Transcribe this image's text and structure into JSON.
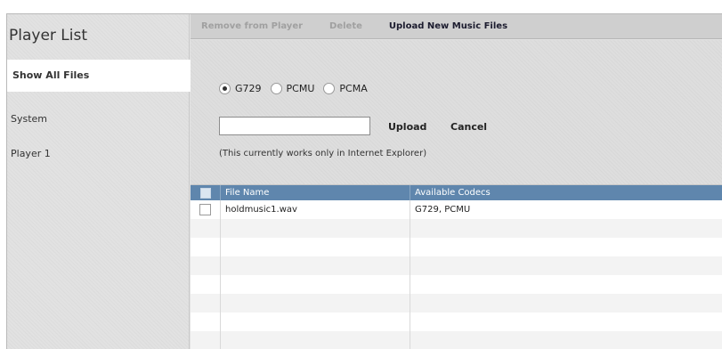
{
  "sidebar": {
    "title": "Player List",
    "items": [
      {
        "label": "Show All Files"
      },
      {
        "label": "System"
      },
      {
        "label": "Player 1"
      }
    ]
  },
  "toolbar": {
    "remove_label": "Remove from Player",
    "delete_label": "Delete",
    "upload_new_label": "Upload New Music Files"
  },
  "upload": {
    "codec_options": [
      "G729",
      "PCMU",
      "PCMA"
    ],
    "selected_codec": "G729",
    "file_value": "",
    "upload_label": "Upload",
    "cancel_label": "Cancel",
    "note": "(This currently works only in Internet Explorer)"
  },
  "table": {
    "columns": [
      "File Name",
      "Available Codecs"
    ],
    "rows": [
      {
        "file_name": "holdmusic1.wav",
        "codecs": "G729, PCMU"
      }
    ]
  }
}
